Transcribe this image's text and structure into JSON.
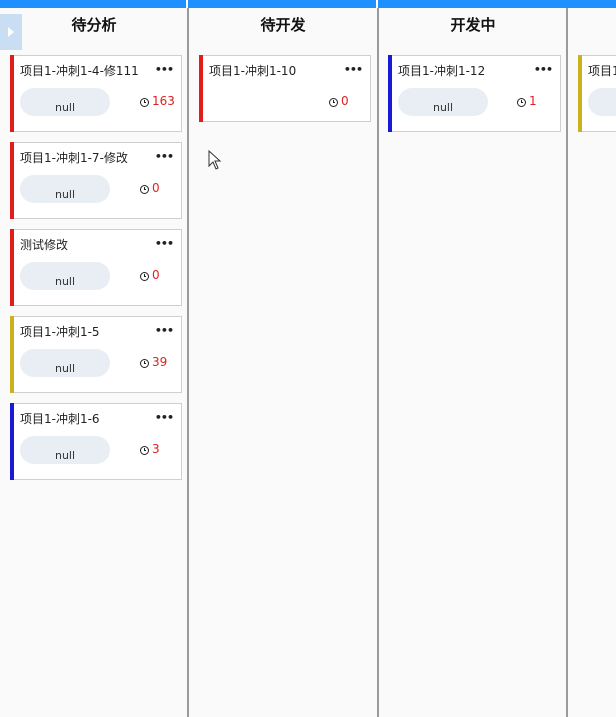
{
  "board": {
    "columns": [
      {
        "title": "待分析",
        "cards": [
          {
            "title": "项目1-冲刺1-4-修111",
            "tag": "null",
            "count": "163",
            "accent": "#e21b1b"
          },
          {
            "title": "项目1-冲刺1-7-修改",
            "tag": "null",
            "count": "0",
            "accent": "#e21b1b"
          },
          {
            "title": "测试修改",
            "tag": "null",
            "count": "0",
            "accent": "#e21b1b"
          },
          {
            "title": "项目1-冲刺1-5",
            "tag": "null",
            "count": "39",
            "accent": "#c9b21b"
          },
          {
            "title": "项目1-冲刺1-6",
            "tag": "null",
            "count": "3",
            "accent": "#1a1ad6"
          }
        ]
      },
      {
        "title": "待开发",
        "cards": [
          {
            "title": "项目1-冲刺1-10",
            "tag": "",
            "count": "0",
            "accent": "#e21b1b"
          }
        ]
      },
      {
        "title": "开发中",
        "cards": [
          {
            "title": "项目1-冲刺1-12",
            "tag": "null",
            "count": "1",
            "accent": "#1a1ad6"
          }
        ]
      },
      {
        "title": "",
        "cards": [
          {
            "title": "项目1",
            "tag": "",
            "count": "",
            "accent": "#c9b21b"
          }
        ]
      }
    ]
  },
  "icons": {
    "collapse": "expand-sidebar-icon",
    "more": "more-dots-icon",
    "clock": "clock-icon",
    "cursor": "mouse-pointer-icon"
  },
  "colors": {
    "header_bar": "#1e90ff",
    "count_text": "#e02020",
    "tag_bg": "#e8eef3",
    "divider": "#9a9a9a"
  }
}
